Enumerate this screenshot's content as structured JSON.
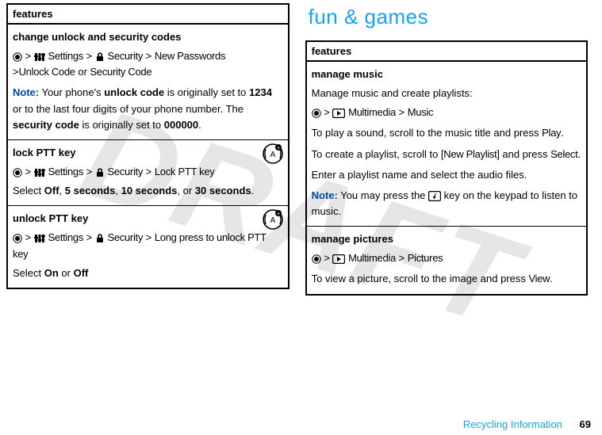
{
  "watermark": "DRAFT",
  "left": {
    "header": "features",
    "r1": {
      "title": "change unlock and security codes",
      "s1": "Settings",
      "s2": "Security",
      "s3": "New Passwords",
      "u1": "Unlock Code",
      "or": "or",
      "u2": "Security Code",
      "noteLabel": "Note:",
      "noteA": " Your phone's ",
      "noteB": "unlock code",
      "noteC": " is originally set to ",
      "noteD": "1234",
      "noteE": " or to the last four digits of your phone number. The ",
      "noteF": "security code",
      "noteG": " is originally set to ",
      "noteH": "000000",
      "noteI": "."
    },
    "r2": {
      "title": "lock PTT key",
      "s1": "Settings",
      "s2": "Security",
      "s3": "Lock PTT key",
      "selA": "Select ",
      "off": "Off",
      "c1": ", ",
      "t5": "5 seconds",
      "c2": ", ",
      "t10": "10 seconds",
      "c3": ", or ",
      "t30": "30 seconds",
      "dot": "."
    },
    "r3": {
      "title": "unlock PTT key",
      "s1": "Settings",
      "s2": "Security",
      "s3": "Long press to unlock PTT key",
      "selA": "Select ",
      "on": "On",
      "or": " or ",
      "off": "Off"
    }
  },
  "right": {
    "heading": "fun & games",
    "header": "features",
    "r1": {
      "title": "manage music",
      "intro": "Manage music and create playlists:",
      "m1": "Multimedia",
      "m2": "Music",
      "pA": "To play a sound, scroll to the music title and press ",
      "play": "Play",
      "pB": ".",
      "cA": "To create a playlist, scroll to ",
      "np": "[New Playlist]",
      "cB": " and press ",
      "sel": "Select",
      "cC": ".",
      "enter": "Enter a playlist name and select the audio files.",
      "noteLabel": "Note:",
      "nA": " You may press the ",
      "nB": " key on the keypad to listen to music."
    },
    "r2": {
      "title": "manage pictures",
      "m1": "Multimedia",
      "m2": "Pictures",
      "vA": "To view a picture, scroll to the image and press ",
      "view": "View",
      "vB": "."
    }
  },
  "footer": {
    "text": "Recycling Information",
    "page": "69"
  }
}
